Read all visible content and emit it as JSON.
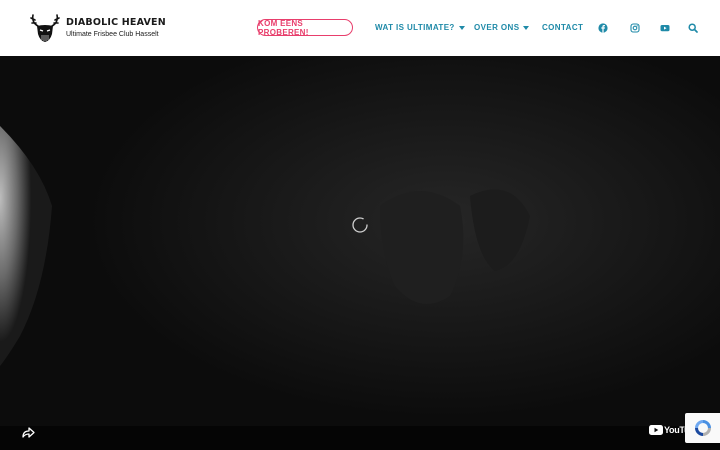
{
  "brand": {
    "title": "DIABOLIC HEAVEN",
    "subtitle": "Ultimate Frisbee Club Hasselt"
  },
  "nav": {
    "cta_label": "KOM EENS PROBEREN!",
    "items": [
      {
        "label": "WAT IS ULTIMATE?",
        "has_dropdown": true
      },
      {
        "label": "OVER ONS",
        "has_dropdown": true
      },
      {
        "label": "CONTACT",
        "has_dropdown": false
      }
    ],
    "icons": [
      "facebook-icon",
      "instagram-icon",
      "youtube-icon",
      "search-icon"
    ]
  },
  "video": {
    "provider_label": "YouTube",
    "state": "loading"
  },
  "colors": {
    "accent_pink": "#e83e6c",
    "nav_teal": "#1f8aa8",
    "video_bg": "#0b0b0b"
  }
}
